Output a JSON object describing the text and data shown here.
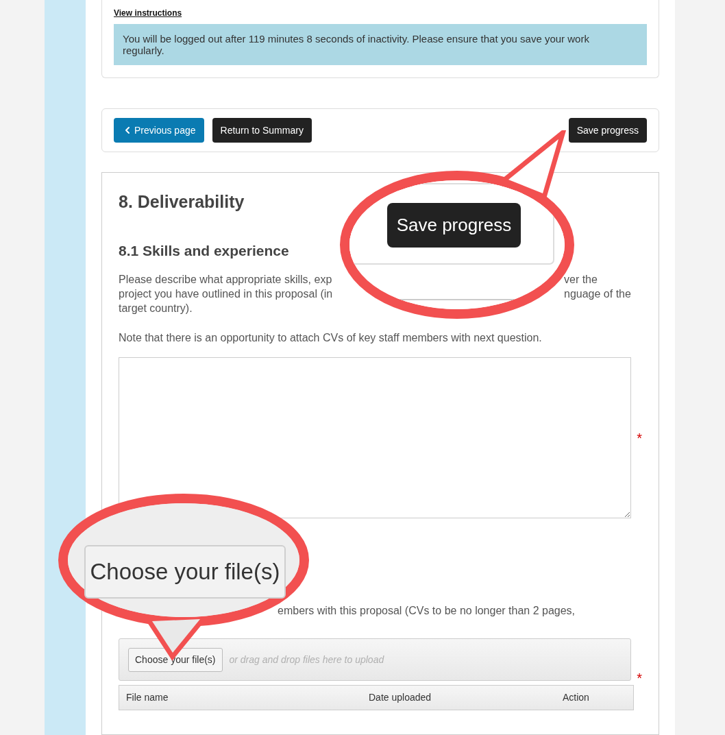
{
  "session_card": {
    "link": "View instructions",
    "notice": "You will be logged out after 119 minutes 8 seconds of inactivity. Please ensure that you save your work regularly."
  },
  "nav_left": [
    {
      "label": "Previous page",
      "kind": "back"
    },
    {
      "label": "Return to Summary",
      "kind": "dark"
    }
  ],
  "nav_right": [
    {
      "label": "Save progress",
      "kind": "dark"
    }
  ],
  "section": {
    "title": "8. Deliverability",
    "subsection": "8.1 Skills and experience",
    "description_lines": [
      {
        "left": "Please describe what appropriate skills, exp",
        "right": "ver the"
      },
      {
        "left": "project you have outlined in this proposal (in",
        "right": "nguage of the"
      },
      {
        "left": "target country)."
      }
    ],
    "note": "Note that there is an opportunity to attach CVs of key staff members with next question.",
    "answer": {
      "required_mark": "*"
    },
    "upload_prompt": "embers with this proposal (CVs to be no longer than 2 pages,",
    "upload": {
      "button": "Choose your file(s)",
      "hint": "or drag and drop files here to upload",
      "required_mark": "*"
    },
    "files_table": {
      "columns": [
        "File name",
        "Date uploaded",
        "Action"
      ]
    }
  },
  "callouts": [
    {
      "label": "Save progress",
      "kind": "card"
    },
    {
      "label": "Choose your file(s)",
      "kind": "dropzone"
    }
  ]
}
